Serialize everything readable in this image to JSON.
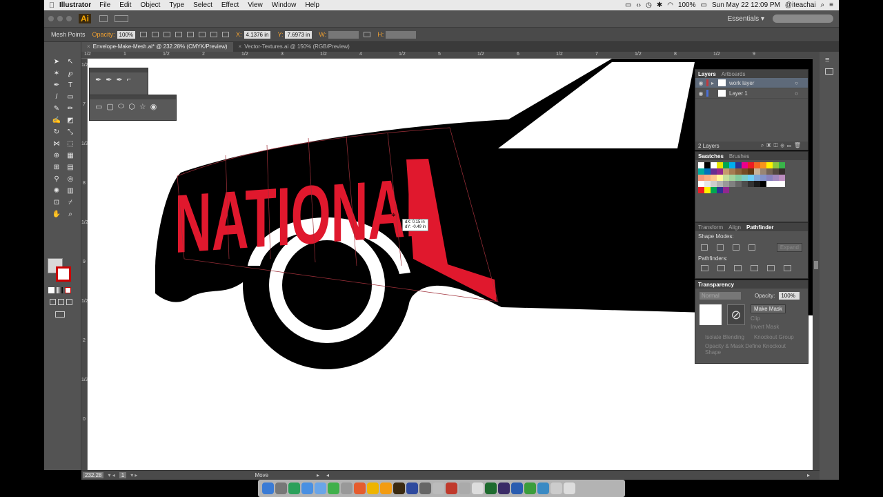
{
  "mac_menubar": {
    "app_name": "Illustrator",
    "menus": [
      "File",
      "Edit",
      "Object",
      "Type",
      "Select",
      "Effect",
      "View",
      "Window",
      "Help"
    ],
    "battery": "100%",
    "datetime": "Sun May 22  12:09 PM",
    "user": "@iteachai"
  },
  "appbar": {
    "logo": "Ai",
    "workspace": "Essentials"
  },
  "controlbar": {
    "mode_label": "Mesh Points",
    "opacity_label": "Opacity:",
    "opacity_value": "100%",
    "x_label": "X:",
    "x_value": "4.1376 in",
    "y_label": "Y:",
    "y_value": "7.6973 in",
    "w_label": "W:",
    "h_label": "H:"
  },
  "tabs": [
    {
      "label": "Envelope-Make-Mesh.ai* @ 232.28% (CMYK/Preview)",
      "active": true
    },
    {
      "label": "Vector-Textures.ai @ 150% (RGB/Preview)",
      "active": false
    }
  ],
  "ruler_top": [
    "1/2",
    "1",
    "1/2",
    "2",
    "1/2",
    "3",
    "1/2",
    "4",
    "1/2",
    "5",
    "1/2",
    "6",
    "1/2",
    "7",
    "1/2",
    "8",
    "1/2",
    "9"
  ],
  "ruler_left": [
    "1/2",
    "7",
    "1/2",
    "8",
    "1/2",
    "9",
    "1/2",
    "2",
    "1/2",
    "0"
  ],
  "canvas": {
    "artwork_text": "NATIONAL",
    "tooltip_dx": "dX: 0.15 in",
    "tooltip_dy": "dY: -0.49 in",
    "colors": {
      "red": "#e0182d",
      "black": "#000000",
      "white": "#ffffff"
    }
  },
  "layers_panel": {
    "tabs": [
      "Layers",
      "Artboards"
    ],
    "layers": [
      {
        "name": "work layer",
        "color": "#c2393e",
        "selected": true
      },
      {
        "name": "Layer 1",
        "color": "#4a6fd6",
        "selected": false
      }
    ],
    "count": "2 Layers"
  },
  "swatches_panel": {
    "tabs": [
      "Swatches",
      "Brushes"
    ],
    "colors": [
      "#ffffff",
      "#000000",
      "#ffffff",
      "#e6e600",
      "#00a651",
      "#00aeef",
      "#2e3192",
      "#ec008c",
      "#ed1c24",
      "#f26522",
      "#f7941d",
      "#fff200",
      "#8dc63f",
      "#39b54a",
      "#00a99d",
      "#0072bc",
      "#662d91",
      "#92278f",
      "#c69c6d",
      "#a67c52",
      "#8c6239",
      "#754c24",
      "#603913",
      "#c7b299",
      "#998675",
      "#736357",
      "#534741",
      "#362f2d",
      "#f7977a",
      "#f9ad81",
      "#fdc68a",
      "#fff79a",
      "#c4df9b",
      "#a3d39c",
      "#82ca9d",
      "#7bcdc8",
      "#6ecff6",
      "#7ea7d8",
      "#8493ca",
      "#8882be",
      "#a187be",
      "#bc8dbf",
      "#ffffff",
      "#e6e6e6",
      "#cccccc",
      "#b3b3b3",
      "#999999",
      "#808080",
      "#666666",
      "#4d4d4d",
      "#333333",
      "#1a1a1a",
      "#000000",
      "#ffffff",
      "#ffffff",
      "#ffffff",
      "#ed1c24",
      "#fff200",
      "#00a651",
      "#2e3192",
      "#92278f",
      "#535353",
      "#535353",
      "#535353",
      "#535353",
      "#535353",
      "#535353",
      "#535353",
      "#535353",
      "#535353"
    ]
  },
  "pathfinder_panel": {
    "tabs": [
      "Transform",
      "Align",
      "Pathfinder"
    ],
    "shape_modes": "Shape Modes:",
    "expand": "Expand",
    "pathfinders": "Pathfinders:"
  },
  "transparency_panel": {
    "title": "Transparency",
    "blend_mode": "Normal",
    "opacity_label": "Opacity:",
    "opacity_value": "100%",
    "make_mask": "Make Mask",
    "clip": "Clip",
    "invert_mask": "Invert Mask",
    "isolate_blending": "Isolate Blending",
    "knockout_group": "Knockout Group",
    "opacity_mask": "Opacity & Mask Define Knockout Shape"
  },
  "statusbar": {
    "zoom": "232.28",
    "artboard": "1",
    "tool": "Move"
  }
}
